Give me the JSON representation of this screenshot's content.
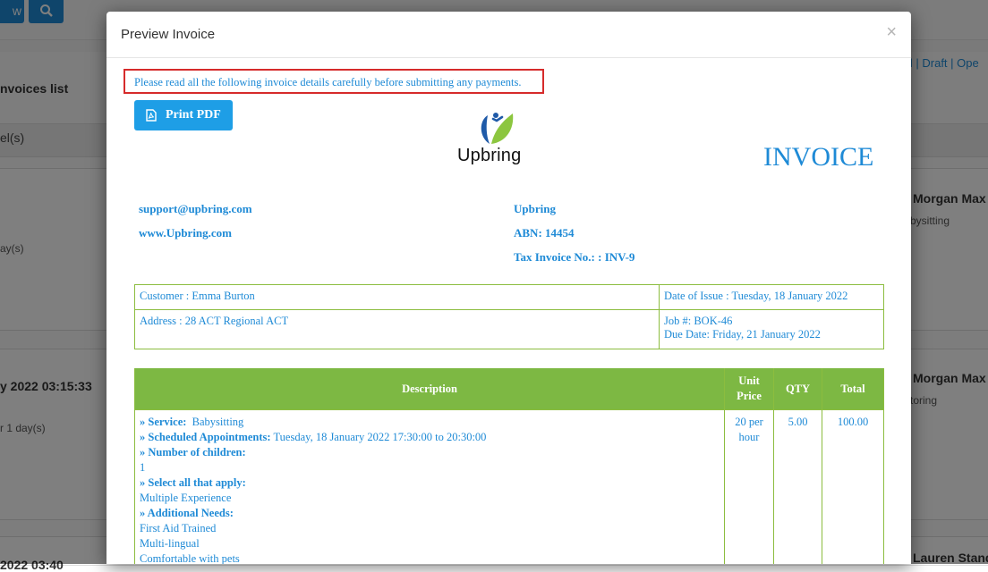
{
  "background": {
    "button_partial_label": "w",
    "list_title": "nvoices list",
    "filter_label": "el(s)",
    "status_links": "ll | Draft | Ope",
    "card1": {
      "person": "Morgan Max",
      "service": "bysitting",
      "duration": "ay(s)"
    },
    "card2": {
      "datetime": "y 2022 03:15:33",
      "person": "Morgan Max",
      "service": "toring",
      "duration": "r 1 day(s)"
    },
    "card3": {
      "person": "Lauren Stand",
      "datetime": "2022 03:40"
    }
  },
  "modal": {
    "title": "Preview Invoice",
    "close_symbol": "×",
    "notice": "Please read all the following invoice details carefully before submitting any payments.",
    "print_label": "Print PDF",
    "logo_text": "Upbring",
    "invoice_heading": "INVOICE",
    "left_info": {
      "email": "support@upbring.com",
      "website": "www.Upbring.com"
    },
    "right_info": {
      "company": "Upbring",
      "abn": "ABN: 14454",
      "tax_invoice": "Tax Invoice No.: : INV-9"
    },
    "customer": {
      "customer": "Customer : Emma Burton",
      "date_of_issue": "Date of Issue : Tuesday, 18 January 2022",
      "address": "Address : 28 ACT Regional ACT",
      "job": "Job #: BOK-46",
      "due_date": "Due Date: Friday, 21 January 2022"
    },
    "items": {
      "headers": {
        "description": "Description",
        "unit_price": "Unit Price",
        "qty": "QTY",
        "total": "Total"
      },
      "row": {
        "service_label": "» Service:",
        "service_value": "Babysitting",
        "appointments_label": "» Scheduled Appointments:",
        "appointments_value": "Tuesday, 18 January 2022 17:30:00 to 20:30:00",
        "children_label": "» Number of children:",
        "children_value": "1",
        "select_label": "» Select all that apply:",
        "select_value": "Multiple Experience",
        "needs_label": "» Additional Needs:",
        "needs_values": [
          "First Aid Trained",
          "Multi-lingual",
          "Comfortable with pets"
        ],
        "unit_price": "20 per hour",
        "qty": "5.00",
        "total": "100.00"
      }
    }
  },
  "colors": {
    "accent": "#1e8ad6",
    "table_header": "#7db843",
    "border": "#8cbd3f",
    "notice_border": "#d62b2b"
  }
}
